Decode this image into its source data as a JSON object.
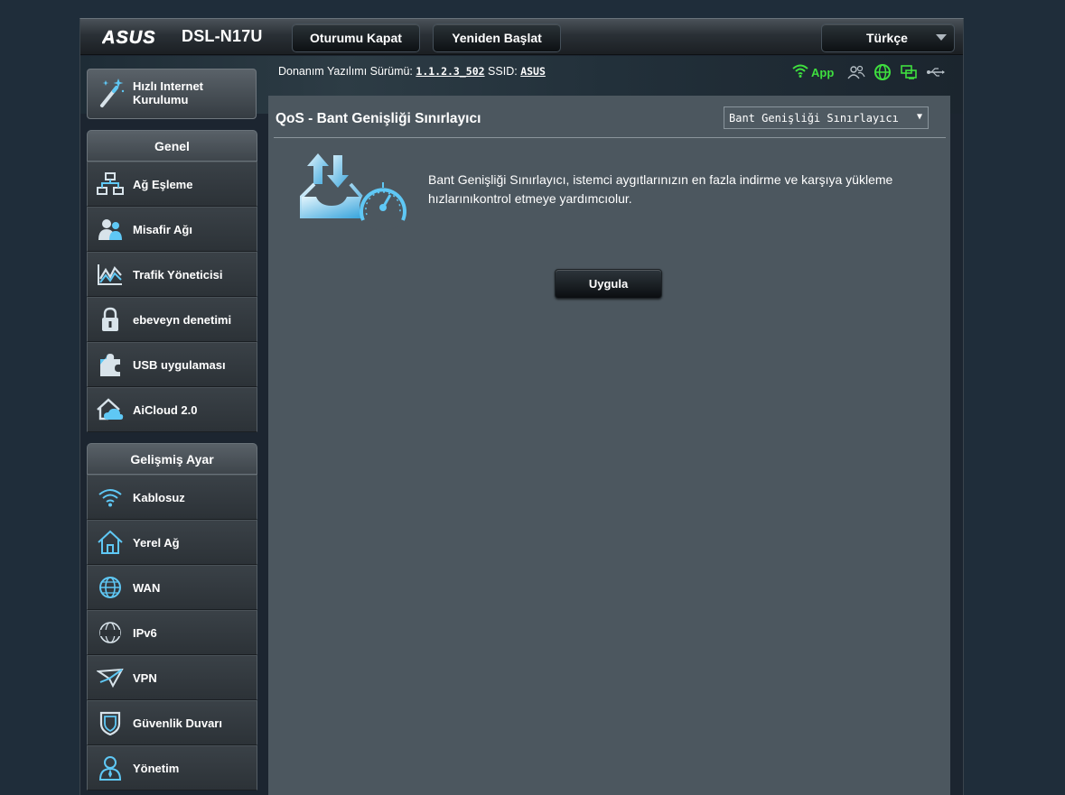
{
  "header": {
    "brand": "ASUS",
    "model": "DSL-N17U",
    "logout_label": "Oturumu Kapat",
    "reboot_label": "Yeniden Başlat",
    "language": "Türkçe"
  },
  "status_bar": {
    "firmware_label": "Donanım Yazılımı Sürümü:",
    "firmware_version": "1.1.2.3_502",
    "ssid_label": "SSID:",
    "ssid_value": "ASUS",
    "app_label": "App",
    "icons": [
      "wifi-icon",
      "clients-icon",
      "internet-globe-icon",
      "network-status-icon",
      "usb-icon"
    ],
    "status_colors": {
      "ok": "#3fdf3f",
      "inactive": "#b7c0c7"
    }
  },
  "sidebar": {
    "quick_setup_label": "Hızlı Internet Kurulumu",
    "general": {
      "heading": "Genel",
      "items": [
        {
          "label": "Ağ Eşleme",
          "icon": "network-map-icon"
        },
        {
          "label": "Misafir Ağı",
          "icon": "guest-network-icon"
        },
        {
          "label": "Trafik Yöneticisi",
          "icon": "traffic-manager-icon"
        },
        {
          "label": "ebeveyn denetimi",
          "icon": "lock-icon"
        },
        {
          "label": "USB uygulaması",
          "icon": "puzzle-icon"
        },
        {
          "label": "AiCloud 2.0",
          "icon": "cloud-home-icon"
        }
      ]
    },
    "advanced": {
      "heading": "Gelişmiş Ayar",
      "items": [
        {
          "label": "Kablosuz",
          "icon": "wifi-icon"
        },
        {
          "label": "Yerel Ağ",
          "icon": "home-icon"
        },
        {
          "label": "WAN",
          "icon": "globe-icon"
        },
        {
          "label": "IPv6",
          "icon": "ipv6-icon"
        },
        {
          "label": "VPN",
          "icon": "vpn-icon"
        },
        {
          "label": "Güvenlik Duvarı",
          "icon": "shield-icon"
        },
        {
          "label": "Yönetim",
          "icon": "user-icon"
        }
      ]
    }
  },
  "main": {
    "title": "QoS - Bant Genişliği Sınırlayıcı",
    "mode_select": "Bant Genişliği Sınırlayıcı",
    "description": "Bant Genişliği Sınırlayıcı, istemci aygıtlarınızın en fazla indirme ve karşıya yükleme hızlarınıkontrol etmeye yardımcıolur.",
    "apply_label": "Uygula"
  },
  "colors": {
    "accent_icon": "#5fc8f5",
    "content_bg": "#4c575f",
    "page_bg": "#1f2d3a"
  }
}
